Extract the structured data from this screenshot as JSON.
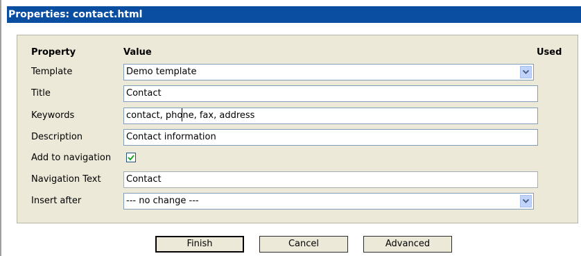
{
  "window": {
    "title": "Properties: contact.html"
  },
  "headers": {
    "property": "Property",
    "value": "Value",
    "used": "Used"
  },
  "rows": [
    {
      "label": "Template",
      "type": "select",
      "value": "Demo template"
    },
    {
      "label": "Title",
      "type": "text",
      "value": "Contact"
    },
    {
      "label": "Keywords",
      "type": "text",
      "value": "contact, phone, fax, address"
    },
    {
      "label": "Description",
      "type": "text",
      "value": "Contact information"
    },
    {
      "label": "Add to navigation",
      "type": "checkbox",
      "checked": true
    },
    {
      "label": "Navigation Text",
      "type": "text",
      "value": "Contact"
    },
    {
      "label": "Insert after",
      "type": "select",
      "value": "--- no change ---"
    }
  ],
  "buttons": {
    "finish": "Finish",
    "cancel": "Cancel",
    "advanced": "Advanced"
  },
  "colors": {
    "titlebar": "#0a4ea2",
    "panel": "#ece9d8",
    "check": "#21a121"
  },
  "icons": {
    "dropdown": "chevron-down-icon",
    "check": "checkmark-icon"
  }
}
